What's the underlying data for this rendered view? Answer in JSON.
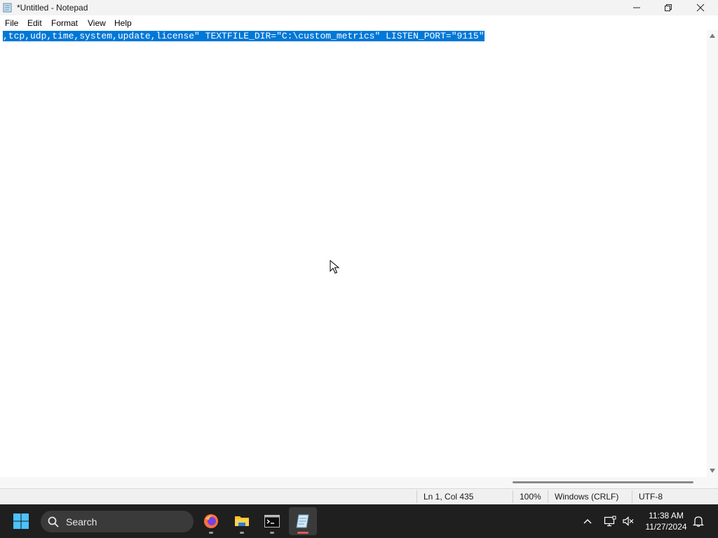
{
  "window": {
    "title": "*Untitled - Notepad",
    "controls": [
      "minimize",
      "maximize",
      "close"
    ]
  },
  "menu": {
    "items": [
      "File",
      "Edit",
      "Format",
      "View",
      "Help"
    ]
  },
  "editor": {
    "text": ",tcp,udp,time,system,update,license\" TEXTFILE_DIR=\"C:\\custom_metrics\" LISTEN_PORT=\"9115\"",
    "selection": "all",
    "selection_color": "#0078d7"
  },
  "statusbar": {
    "position": "Ln 1, Col 435",
    "zoom": "100%",
    "line_ending": "Windows (CRLF)",
    "encoding": "UTF-8"
  },
  "taskbar": {
    "search_label": "Search",
    "apps": [
      {
        "name": "firefox-icon",
        "active": false
      },
      {
        "name": "file-explorer-icon",
        "active": false
      },
      {
        "name": "terminal-icon",
        "active": false
      },
      {
        "name": "notepad-icon",
        "active": true
      }
    ],
    "clock": {
      "time": "11:38 AM",
      "date": "11/27/2024"
    }
  }
}
